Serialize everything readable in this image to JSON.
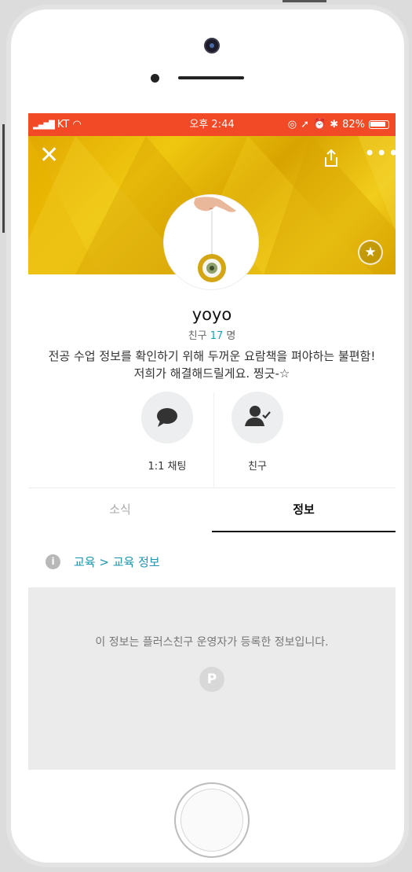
{
  "status_bar": {
    "carrier": "KT",
    "time": "오후 2:44",
    "battery": "82%"
  },
  "profile": {
    "name": "yoyo",
    "friends_label": "친구",
    "friends_count": "17",
    "friends_unit": "명",
    "description": "전공 수업 정보를 확인하기 위해  두꺼운 요람책을 펴야하는 불편함! 저희가 해결해드릴게요. 찡긋-☆"
  },
  "actions": {
    "chat_label": "1:1 채팅",
    "friend_label": "친구"
  },
  "tabs": {
    "news": "소식",
    "info": "정보"
  },
  "category": {
    "path": "교육 > 교육 정보"
  },
  "info_box": {
    "text": "이 정보는 플러스친구 운영자가 등록한 정보입니다."
  },
  "colors": {
    "status_bar": "#f24a27",
    "banner": "#e8b800",
    "accent": "#1a96ad"
  },
  "icons": {
    "close": "close-icon",
    "share": "share-icon",
    "more": "more-icon",
    "star": "star-icon",
    "chat": "chat-bubble-icon",
    "friend": "person-check-icon",
    "info": "info-icon",
    "logo": "plus-friend-logo"
  }
}
